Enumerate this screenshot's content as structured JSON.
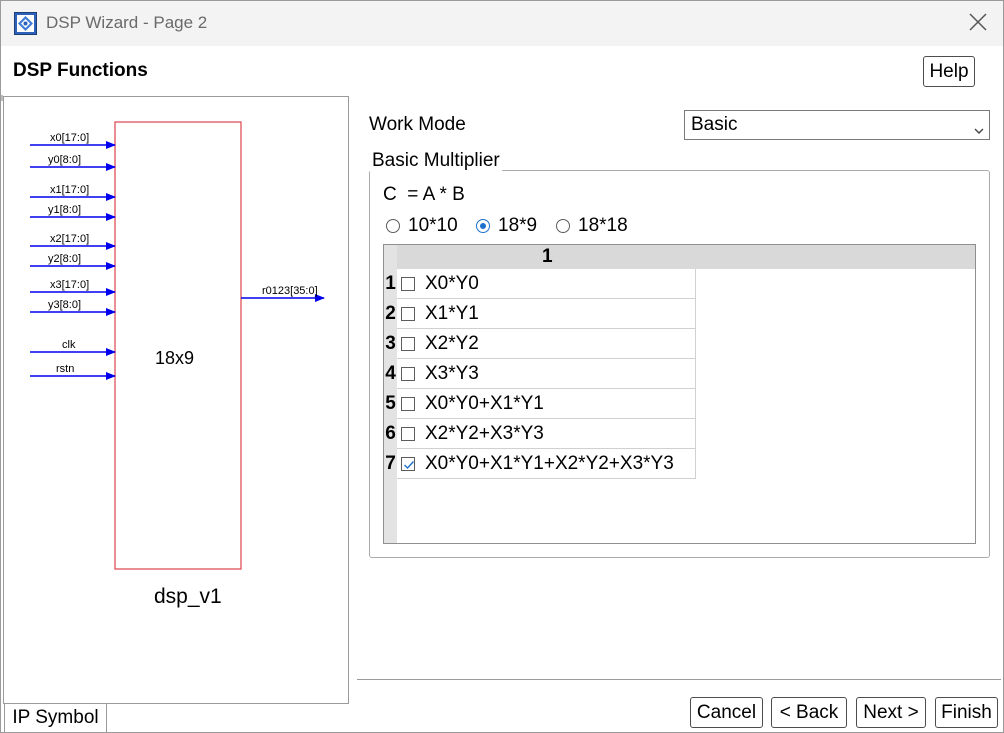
{
  "window": {
    "title": "DSP Wizard - Page 2"
  },
  "header": {
    "title": "DSP Functions",
    "help_label": "Help"
  },
  "symbol": {
    "block_label": "18x9",
    "module_name": "dsp_v1",
    "inputs": [
      "x0[17:0]",
      "y0[8:0]",
      "x1[17:0]",
      "y1[8:0]",
      "x2[17:0]",
      "y2[8:0]",
      "x3[17:0]",
      "y3[8:0]",
      "clk",
      "rstn"
    ],
    "output": "r0123[35:0]",
    "colors": {
      "block_border": "#e0505a",
      "wires": "#0000ee"
    }
  },
  "tabs": {
    "ip_symbol": "IP Symbol"
  },
  "work_mode": {
    "label": "Work Mode",
    "selected": "Basic"
  },
  "multiplier": {
    "group_title": "Basic Multiplier",
    "formula": "C  = A * B",
    "options": [
      {
        "label": "10*10",
        "checked": false
      },
      {
        "label": "18*9",
        "checked": true
      },
      {
        "label": "18*18",
        "checked": false
      }
    ]
  },
  "table": {
    "column_header": "1",
    "rows": [
      {
        "num": "1",
        "label": "X0*Y0",
        "checked": false
      },
      {
        "num": "2",
        "label": "X1*Y1",
        "checked": false
      },
      {
        "num": "3",
        "label": "X2*Y2",
        "checked": false
      },
      {
        "num": "4",
        "label": "X3*Y3",
        "checked": false
      },
      {
        "num": "5",
        "label": "X0*Y0+X1*Y1",
        "checked": false
      },
      {
        "num": "6",
        "label": "X2*Y2+X3*Y3",
        "checked": false
      },
      {
        "num": "7",
        "label": "X0*Y0+X1*Y1+X2*Y2+X3*Y3",
        "checked": true
      }
    ]
  },
  "footer": {
    "cancel_label": "Cancel",
    "back_label": "< Back",
    "next_label": "Next >",
    "finish_label": "Finish"
  },
  "icons": {
    "app": "dsp-app-icon",
    "close": "close-icon",
    "dropdown": "chevron-down-icon",
    "check": "checkmark-icon"
  },
  "colors": {
    "accent": "#1e70cd",
    "titlebar_bg": "#f3f3f3"
  }
}
